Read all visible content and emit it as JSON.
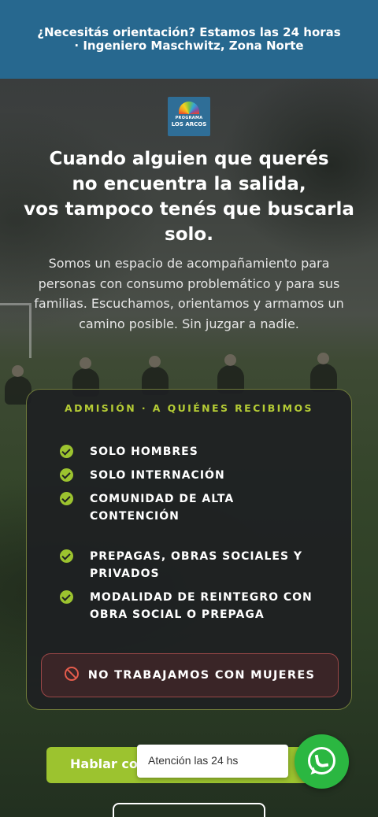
{
  "topbar": {
    "line1": "¿Necesitás orientación? Estamos las 24 horas",
    "line2": "· Ingeniero Maschwitz, Zona Norte"
  },
  "logo": {
    "small": "PROGRAMA",
    "big": "LOS ARCOS"
  },
  "hero": {
    "headline_lines": [
      "Cuando alguien que querés",
      "no encuentra la salida,",
      "vos tampoco tenés que buscarla",
      "solo."
    ],
    "subtext": "Somos un espacio de acompañamiento para personas con consumo problemático y para sus familias. Escuchamos, orientamos y armamos un camino posible. Sin juzgar a nadie."
  },
  "admission": {
    "title": "ADMISIÓN · A QUIÉNES RECIBIMOS",
    "items": [
      "SOLO HOMBRES",
      "SOLO INTERNACIÓN",
      "COMUNIDAD DE ALTA CONTENCIÓN",
      "PREPAGAS, OBRAS SOCIALES Y PRIVADOS",
      "MODALIDAD DE REINTEGRO CON OBRA SOCIAL O PREPAGA"
    ],
    "warning": "NO TRABAJAMOS CON MUJERES"
  },
  "cta": {
    "label": "Hablar con"
  },
  "tooltip": {
    "text": "Atención las 24 hs"
  },
  "icons": {
    "check": "check-circle-icon",
    "warning": "ban-icon",
    "whatsapp": "whatsapp-icon"
  },
  "colors": {
    "topbar": "#27688f",
    "accent": "#9cc32f",
    "card_title": "#b5cc35",
    "warning_border": "#9b4747",
    "whatsapp": "#2bb741"
  }
}
